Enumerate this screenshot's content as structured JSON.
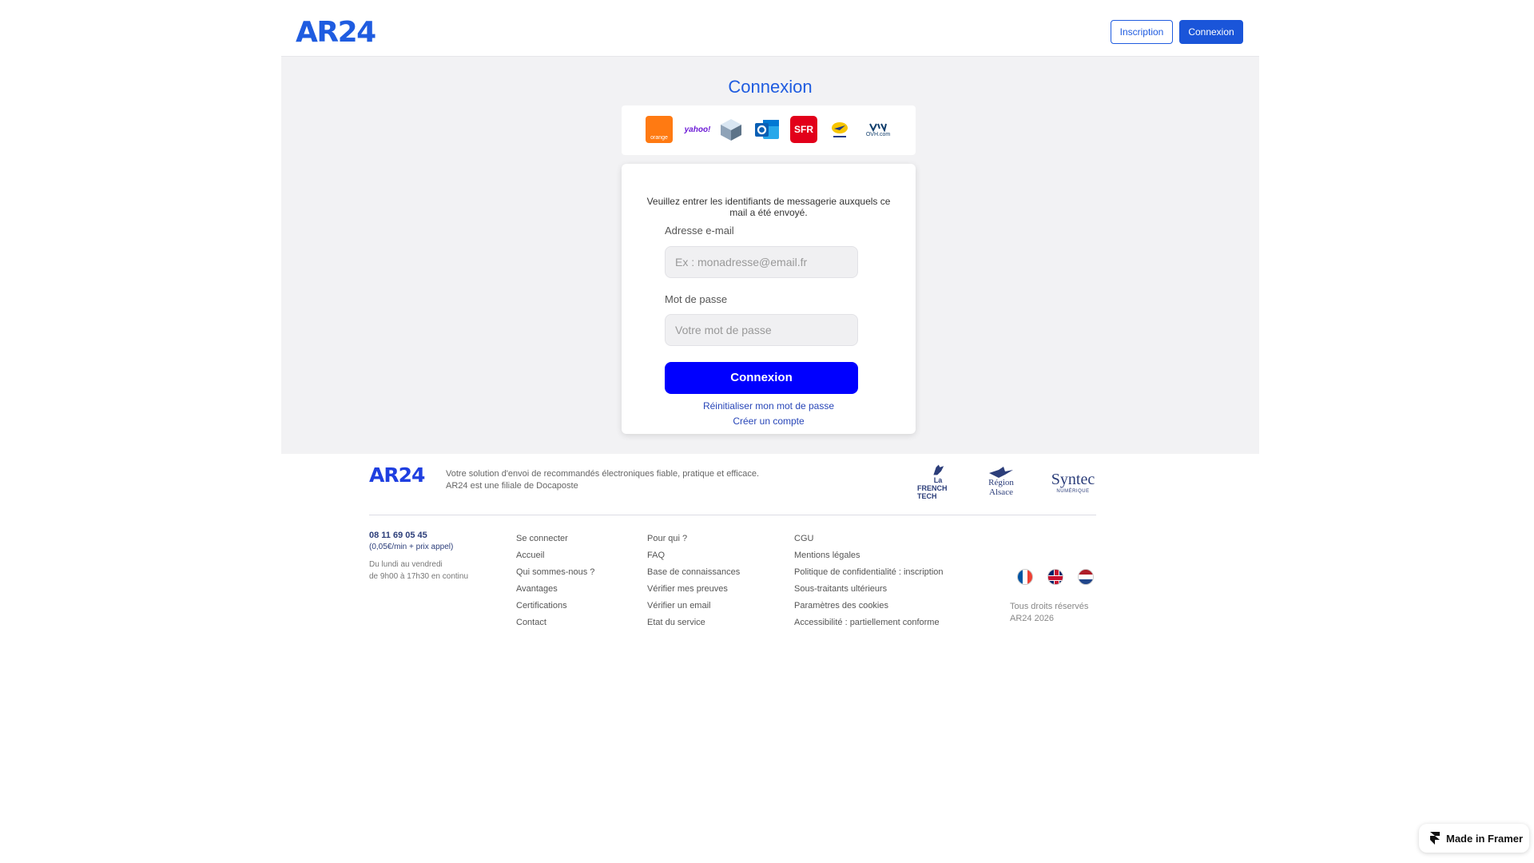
{
  "header": {
    "logo": "AR24",
    "inscription_label": "Inscription",
    "connexion_label": "Connexion"
  },
  "login": {
    "title": "Connexion",
    "providers": [
      "orange",
      "yahoo!",
      "SFR",
      "OVH.com"
    ],
    "instructions": "Veuillez entrer les identifiants de messagerie auxquels ce mail a été envoyé.",
    "email_label": "Adresse e-mail",
    "email_placeholder": "Ex : monadresse@email.fr",
    "password_label": "Mot de passe",
    "password_placeholder": "Votre mot de passe",
    "submit_label": "Connexion",
    "reset_link": "Réinitialiser mon mot de passe",
    "create_link": "Créer un compte"
  },
  "footer": {
    "logo": "AR24",
    "tagline_1": "Votre solution d'envoi de recommandés électroniques fiable, pratique et efficace.",
    "tagline_2": "AR24 est une filiale de Docaposte",
    "partners": {
      "french_tech_1": "La",
      "french_tech_2": "FRENCH TECH",
      "region_1": "Région",
      "region_2": "Alsace",
      "syntec_1": "Syntec",
      "syntec_2": "NUMÉRIQUE"
    },
    "phone": "08 11 69 05 45",
    "price": "(0,05€/min + prix appel)",
    "hours_1": "Du lundi au vendredi",
    "hours_2": "de 9h00 à 17h30 en continu",
    "col1": [
      "Se connecter",
      "Accueil",
      "Qui sommes-nous ?",
      "Avantages",
      "Certifications",
      "Contact"
    ],
    "col2": [
      "Pour qui ?",
      "FAQ",
      "Base de connaissances",
      "Vérifier mes preuves",
      "Vérifier un email",
      "Etat du service"
    ],
    "col3": [
      "CGU",
      "Mentions légales",
      "Politique de confidentialité : inscription",
      "Sous-traitants ultérieurs",
      "Paramètres des cookies",
      "Accessibilité : partiellement conforme"
    ],
    "rights_1": "Tous droits réservés",
    "rights_2": "AR24 2026"
  },
  "badge": {
    "label": "Made in Framer"
  },
  "colors": {
    "brand_blue": "#1f5ce0",
    "submit_blue": "#0000ff",
    "gray_bg": "#f2f2f4"
  }
}
